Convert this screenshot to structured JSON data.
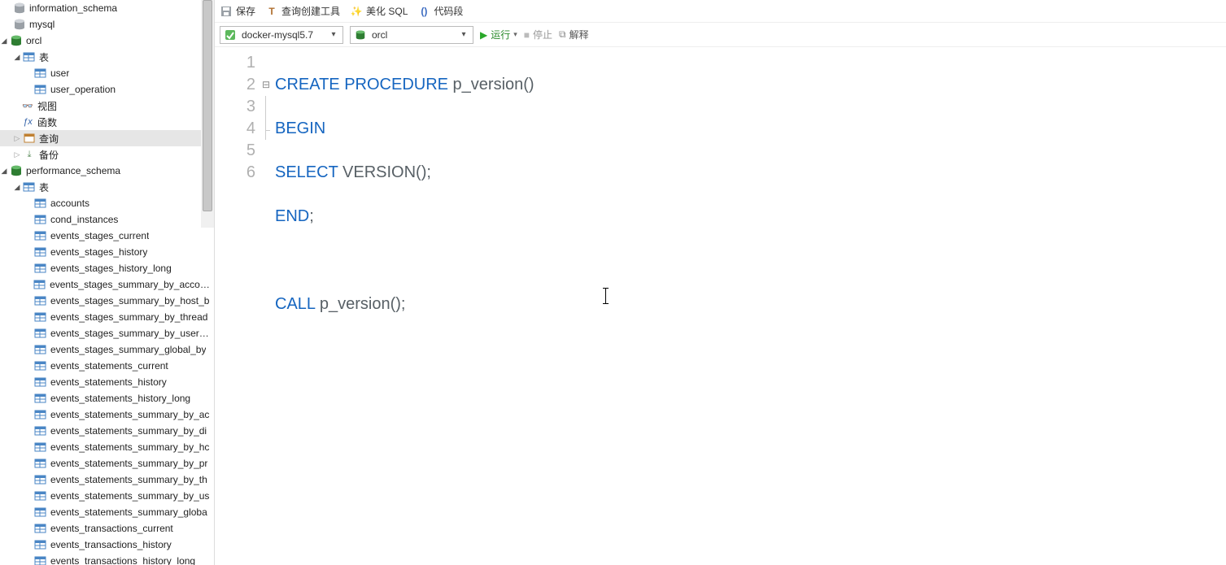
{
  "toolbar1": {
    "save": "保存",
    "queryBuilder": "查询创建工具",
    "beautify": "美化 SQL",
    "snippet": "代码段"
  },
  "toolbar2": {
    "connection": "docker-mysql5.7",
    "database": "orcl",
    "run": "运行",
    "stop": "停止",
    "explain": "解释"
  },
  "editor": {
    "lines": [
      "1",
      "2",
      "3",
      "4",
      "5",
      "6"
    ],
    "code": {
      "l1a": "CREATE",
      "l1b": " ",
      "l1c": "PROCEDURE",
      "l1d": " p_version()",
      "l2a": "BEGIN",
      "l3a": "SELECT",
      "l3b": " VERSION();",
      "l4a": "END",
      "l4b": ";",
      "l6a": "CALL",
      "l6b": " p_version();"
    }
  },
  "tree": {
    "db1": "information_schema",
    "db2": "mysql",
    "db3": "orcl",
    "tables_label": "表",
    "t_user": "user",
    "t_user_op": "user_operation",
    "views": "视图",
    "functions": "函数",
    "queries": "查询",
    "backup": "备份",
    "db4": "performance_schema",
    "ps_tables": [
      "accounts",
      "cond_instances",
      "events_stages_current",
      "events_stages_history",
      "events_stages_history_long",
      "events_stages_summary_by_account",
      "events_stages_summary_by_host_b",
      "events_stages_summary_by_thread",
      "events_stages_summary_by_user_b",
      "events_stages_summary_global_by",
      "events_statements_current",
      "events_statements_history",
      "events_statements_history_long",
      "events_statements_summary_by_ac",
      "events_statements_summary_by_di",
      "events_statements_summary_by_hc",
      "events_statements_summary_by_pr",
      "events_statements_summary_by_th",
      "events_statements_summary_by_us",
      "events_statements_summary_globa",
      "events_transactions_current",
      "events_transactions_history",
      "events_transactions_history_long"
    ]
  }
}
